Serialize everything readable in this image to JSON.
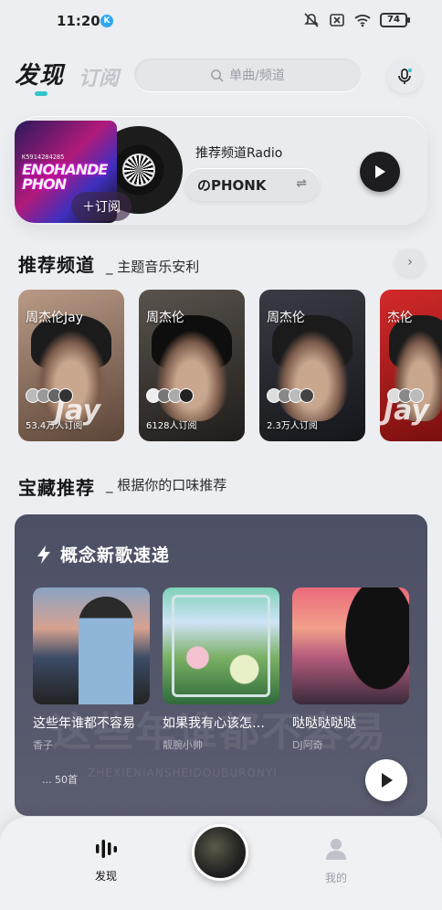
{
  "status_bar": {
    "time": "11:20",
    "badge": "K",
    "battery": "74"
  },
  "header": {
    "tab_active": "发现",
    "tab_inactive": "订阅",
    "search_placeholder": "单曲/频道",
    "icons": [
      "search-icon",
      "mic-icon"
    ]
  },
  "radio": {
    "cover_text": "ENOHANDE PHON",
    "cover_code": "K5914284285",
    "subscribe_label": "＋订阅",
    "title": "推荐频道Radio",
    "channel_chip": "のPHONK",
    "icons": [
      "swap-icon",
      "play-icon"
    ]
  },
  "recommended_channels": {
    "title": "推荐频道",
    "subtitle": "_ 主题音乐安利",
    "more_icon": "chevron-right-icon",
    "items": [
      {
        "name": "周杰伦Jay",
        "subscribers": "53.4万人订阅",
        "big_text": "Jay",
        "color": "#8b6a58"
      },
      {
        "name": "周杰伦",
        "subscribers": "6128人订阅",
        "big_text": "",
        "color": "#3f3a36"
      },
      {
        "name": "周杰伦",
        "subscribers": "2.3万人订阅",
        "big_text": "",
        "color": "#2b2c33"
      },
      {
        "name": "杰伦",
        "subscribers": "",
        "big_text": "Jay",
        "color": "#b21c1c"
      }
    ]
  },
  "treasure": {
    "title": "宝藏推荐",
    "subtitle": "_ 根据你的口味推荐",
    "card_title": "概念新歌速递",
    "bg_text": "这些年谁都不容易",
    "bg_text_latin": "ZHEXIENIANSHEIDOUBURONYI",
    "songs": [
      {
        "name": "这些年谁都不容易",
        "artist": "香子"
      },
      {
        "name": "如果我有心该怎…",
        "artist": "靓腕小帅"
      },
      {
        "name": "哒哒哒哒哒",
        "artist": "DJ阿奇"
      }
    ],
    "count": "... 50首",
    "icons": [
      "lightning-icon",
      "play-icon"
    ]
  },
  "bottom_nav": {
    "items": [
      {
        "label": "发现",
        "icon": "discover-icon"
      },
      {
        "label": "",
        "icon": "now-playing-disc"
      },
      {
        "label": "我的",
        "icon": "profile-icon"
      }
    ]
  }
}
